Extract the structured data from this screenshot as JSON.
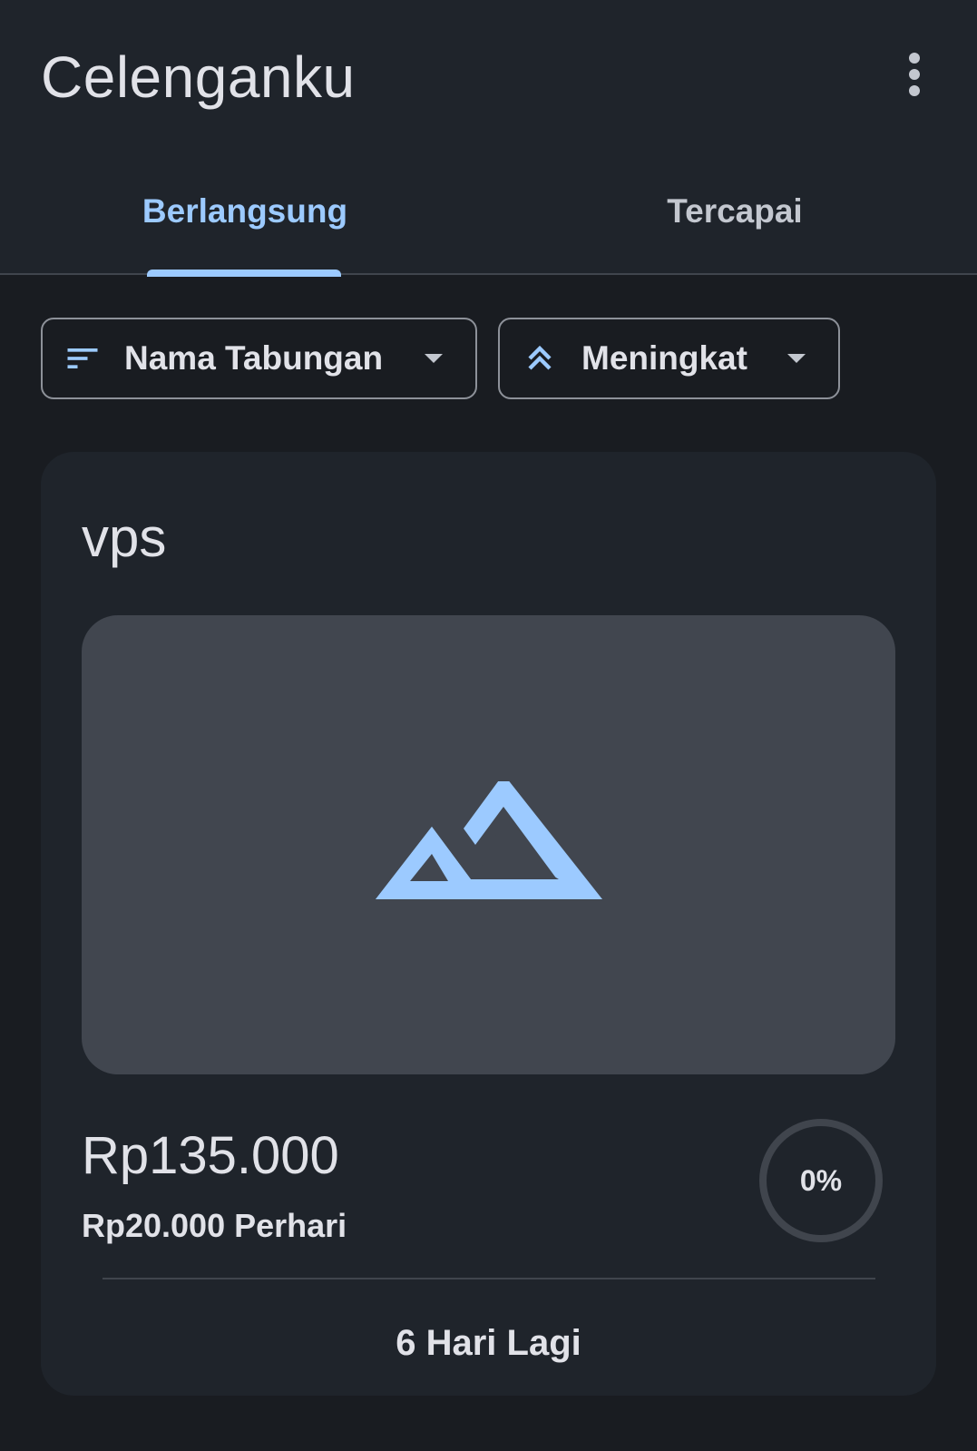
{
  "app": {
    "title": "Celenganku"
  },
  "tabs": [
    {
      "label": "Berlangsung",
      "selected": true
    },
    {
      "label": "Tercapai",
      "selected": false
    }
  ],
  "filters": {
    "sort_by": {
      "label": "Nama Tabungan",
      "icon": "sort-icon"
    },
    "order": {
      "label": "Meningkat",
      "icon": "double-chevron-up-icon"
    }
  },
  "savings": [
    {
      "name": "vps",
      "image_icon": "image-placeholder-icon",
      "target_amount": "Rp135.000",
      "per_day": "Rp20.000 Perhari",
      "progress_label": "0%",
      "progress_value": 0,
      "days_left": "6 Hari Lagi"
    }
  ],
  "colors": {
    "accent": "#9ccaff",
    "background": "#191c21",
    "surface": "#1f242b",
    "image_bg": "#41464f",
    "progress_track": "#40454d"
  }
}
